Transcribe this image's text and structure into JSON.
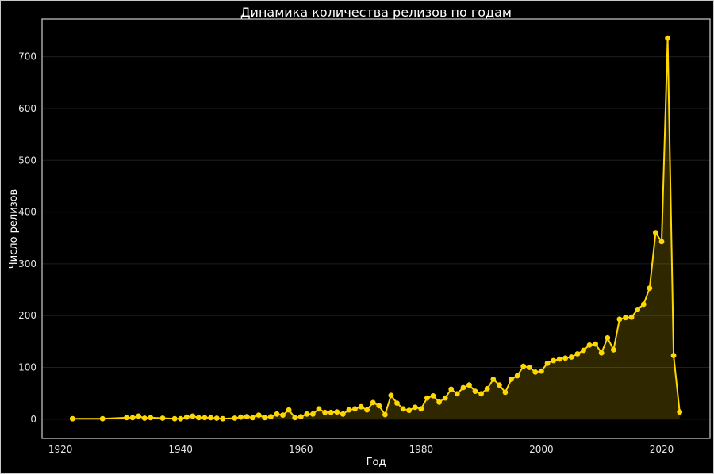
{
  "window": {
    "background_color": "#000000",
    "border_color": "#c8c8c8"
  },
  "chart_data": {
    "type": "area",
    "title": "Динамика количества релизов по годам",
    "xlabel": "Год",
    "ylabel": "Число релизов",
    "x": [
      1922,
      1927,
      1931,
      1932,
      1933,
      1934,
      1935,
      1937,
      1939,
      1940,
      1941,
      1942,
      1943,
      1944,
      1945,
      1946,
      1947,
      1949,
      1950,
      1951,
      1952,
      1953,
      1954,
      1955,
      1956,
      1957,
      1958,
      1959,
      1960,
      1961,
      1962,
      1963,
      1964,
      1965,
      1966,
      1967,
      1968,
      1969,
      1970,
      1971,
      1972,
      1973,
      1974,
      1975,
      1976,
      1977,
      1978,
      1979,
      1980,
      1981,
      1982,
      1983,
      1984,
      1985,
      1986,
      1987,
      1988,
      1989,
      1990,
      1991,
      1992,
      1993,
      1994,
      1995,
      1996,
      1997,
      1998,
      1999,
      2000,
      2001,
      2002,
      2003,
      2004,
      2005,
      2006,
      2007,
      2008,
      2009,
      2010,
      2011,
      2012,
      2013,
      2014,
      2015,
      2016,
      2017,
      2018,
      2019,
      2020,
      2021,
      2022,
      2023
    ],
    "values": [
      1,
      1,
      3,
      3,
      6,
      2,
      3,
      2,
      1,
      1,
      4,
      6,
      3,
      3,
      3,
      2,
      1,
      2,
      4,
      5,
      3,
      8,
      3,
      5,
      10,
      8,
      18,
      3,
      5,
      10,
      10,
      20,
      13,
      13,
      14,
      10,
      18,
      20,
      24,
      18,
      32,
      26,
      9,
      46,
      31,
      20,
      17,
      23,
      20,
      41,
      45,
      33,
      41,
      58,
      49,
      61,
      66,
      54,
      49,
      59,
      77,
      66,
      52,
      77,
      84,
      102,
      100,
      91,
      93,
      108,
      113,
      116,
      118,
      120,
      126,
      133,
      143,
      145,
      128,
      157,
      134,
      193,
      196,
      197,
      212,
      222,
      253,
      360,
      343,
      736,
      123,
      14
    ],
    "xticks": [
      1920,
      1940,
      1960,
      1980,
      2000,
      2020
    ],
    "yticks": [
      0,
      100,
      200,
      300,
      400,
      500,
      600,
      700
    ],
    "xlim": [
      1916.95,
      2028.05
    ],
    "ylim": [
      -37,
      773
    ],
    "grid": "horizontal",
    "legend": "none",
    "line_color": "#FFD700",
    "fill_color": "#FFD700",
    "fill_opacity": 0.18,
    "marker": "circle",
    "marker_radius": 3.4,
    "grid_color": "#1e1e1e",
    "spine_color": "#cfcfcf",
    "text_color": "#ffffff",
    "tick_color": "#e6e6e6",
    "plot_background": "#000000"
  }
}
